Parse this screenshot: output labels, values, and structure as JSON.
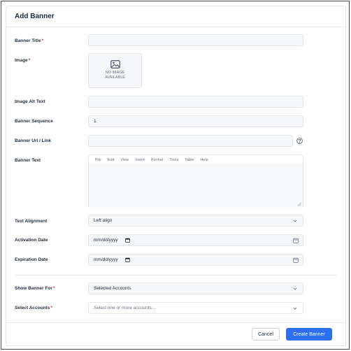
{
  "dialog": {
    "title": "Add Banner"
  },
  "fields": {
    "banner_title": {
      "label": "Banner Title",
      "required": "*",
      "value": ""
    },
    "image": {
      "label": "Image",
      "required": "*",
      "placeholder_line1": "NO IMAGE",
      "placeholder_line2": "AVAILABLE",
      "icon": "image-icon"
    },
    "image_alt_text": {
      "label": "Image Alt Text",
      "value": ""
    },
    "banner_sequence": {
      "label": "Banner Sequence",
      "value": "1"
    },
    "banner_url": {
      "label": "Banner Url / Link",
      "value": "",
      "help_icon": "question-circle-icon"
    },
    "banner_text": {
      "label": "Banner Text",
      "menu": [
        "File",
        "Edit",
        "View",
        "Insert",
        "Format",
        "Tools",
        "Table",
        "Help"
      ],
      "value": ""
    },
    "text_alignment": {
      "label": "Text Alignment",
      "value": "Left align"
    },
    "activation_date": {
      "label": "Activation Date",
      "value": "mm/dd/yyyy"
    },
    "expiration_date": {
      "label": "Expiration Date",
      "value": "mm/dd/yyyy"
    },
    "show_banner_for": {
      "label": "Show Banner For",
      "required": "*",
      "value": "Selected Accounts"
    },
    "select_accounts": {
      "label": "Select Accounts",
      "required": "*",
      "placeholder": "Select one or more accounts..."
    }
  },
  "footer": {
    "cancel_label": "Cancel",
    "create_label": "Create Banner"
  },
  "colors": {
    "primary": "#2e6ff2",
    "required": "#dc2626"
  }
}
